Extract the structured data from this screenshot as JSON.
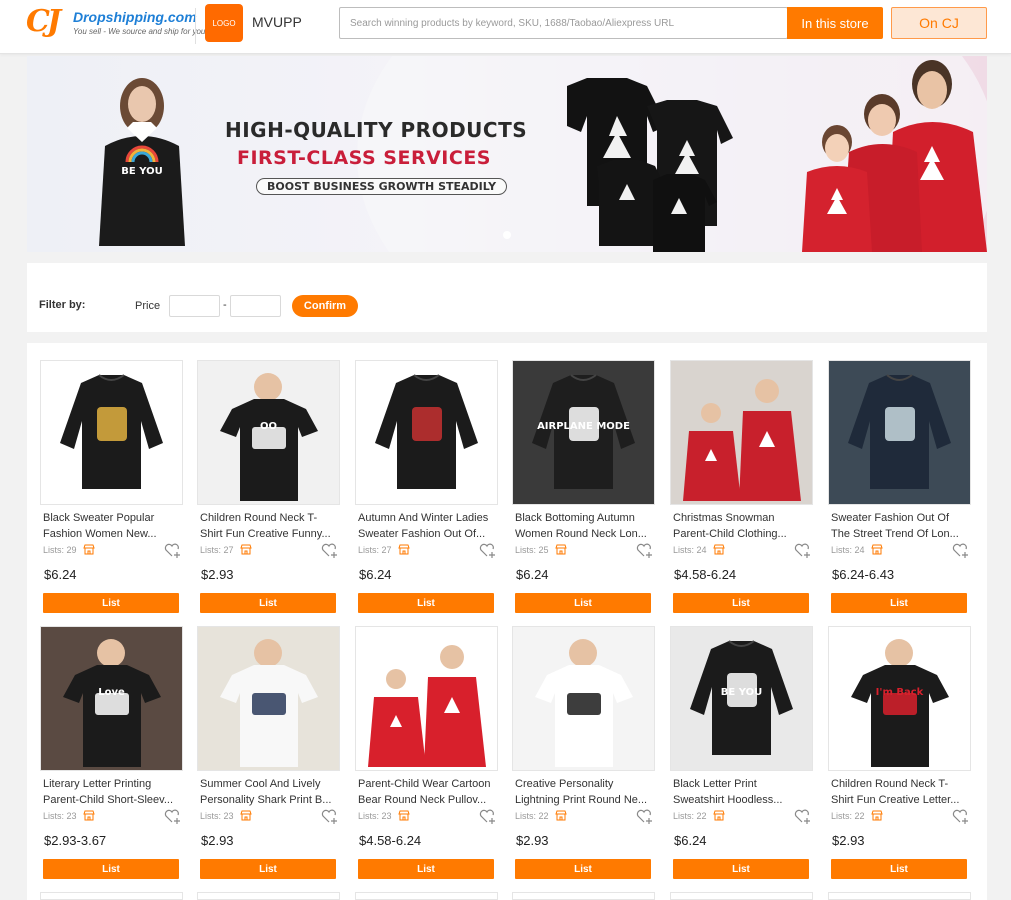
{
  "header": {
    "logo_name": "Dropshipping.com",
    "logo_tagline": "You sell - We source and ship for you!",
    "store_logo_text": "LOGO",
    "store_name": "MVUPP",
    "search_placeholder": "Search winning products by keyword, SKU, 1688/Taobao/Aliexpress URL",
    "in_store_label": "In this store",
    "on_cj_label": "On CJ"
  },
  "banner": {
    "line1": "HIGH-QUALITY  PRODUCTS",
    "line2": "FIRST-CLASS  SERVICES",
    "line3": "BOOST BUSINESS GROWTH STEADILY"
  },
  "filter": {
    "label": "Filter by:",
    "price_label": "Price",
    "separator": "-",
    "min_value": "",
    "max_value": "",
    "confirm_label": "Confirm"
  },
  "products": [
    {
      "title1": "Black Sweater Popular",
      "title2": "Fashion Women New...",
      "lists": "Lists: 29",
      "price": "$6.24",
      "button": "List"
    },
    {
      "title1": "Children Round Neck T-",
      "title2": "Shirt Fun Creative Funny...",
      "lists": "Lists: 27",
      "price": "$2.93",
      "button": "List"
    },
    {
      "title1": "Autumn And Winter Ladies",
      "title2": "Sweater Fashion Out Of...",
      "lists": "Lists: 27",
      "price": "$6.24",
      "button": "List"
    },
    {
      "title1": "Black Bottoming Autumn",
      "title2": "Women Round Neck Lon...",
      "lists": "Lists: 25",
      "price": "$6.24",
      "button": "List"
    },
    {
      "title1": "Christmas Snowman",
      "title2": "Parent-Child Clothing...",
      "lists": "Lists: 24",
      "price": "$4.58-6.24",
      "button": "List"
    },
    {
      "title1": "Sweater Fashion Out Of",
      "title2": "The Street Trend Of Lon...",
      "lists": "Lists: 24",
      "price": "$6.24-6.43",
      "button": "List"
    },
    {
      "title1": "Literary Letter Printing",
      "title2": "Parent-Child Short-Sleev...",
      "lists": "Lists: 23",
      "price": "$2.93-3.67",
      "button": "List"
    },
    {
      "title1": "Summer Cool And Lively",
      "title2": "Personality Shark Print B...",
      "lists": "Lists: 23",
      "price": "$2.93",
      "button": "List"
    },
    {
      "title1": "Parent-Child Wear Cartoon",
      "title2": "Bear Round Neck Pullov...",
      "lists": "Lists: 23",
      "price": "$4.58-6.24",
      "button": "List"
    },
    {
      "title1": "Creative Personality",
      "title2": "Lightning Print Round Ne...",
      "lists": "Lists: 22",
      "price": "$2.93",
      "button": "List"
    },
    {
      "title1": "Black Letter Print",
      "title2": "Sweatshirt Hoodless...",
      "lists": "Lists: 22",
      "price": "$6.24",
      "button": "List"
    },
    {
      "title1": "Children Round Neck T-",
      "title2": "Shirt Fun Creative Letter...",
      "lists": "Lists: 22",
      "price": "$2.93",
      "button": "List"
    }
  ],
  "thumb_art": {
    "1": {
      "bg": "#ffffff",
      "item": "sweater",
      "color": "#1b1b1b",
      "print_text": "",
      "print_color": "#e0b040"
    },
    "2": {
      "bg": "#f1f1f1",
      "item": "tee",
      "color": "#1b1b1b",
      "print_text": "OO",
      "print_color": "#ffffff"
    },
    "3": {
      "bg": "#ffffff",
      "item": "sweater",
      "color": "#1b1b1b",
      "print_text": "",
      "print_color": "#c53030"
    },
    "4": {
      "bg": "#3a3a3a",
      "item": "sweater",
      "color": "#1e1e1e",
      "print_text": "AIRPLANE MODE",
      "print_color": "#ffffff"
    },
    "5": {
      "bg": "#d9d4cf",
      "item": "family",
      "color": "#c8202c",
      "print_text": "",
      "print_color": "#ffffff"
    },
    "6": {
      "bg": "#3d4a56",
      "item": "sweater",
      "color": "#1f2a3a",
      "print_text": "",
      "print_color": "#c9d9e0"
    },
    "7": {
      "bg": "#5a4a42",
      "item": "tee",
      "color": "#1b1b1b",
      "print_text": "Love",
      "print_color": "#ffffff"
    },
    "8": {
      "bg": "#e7e3da",
      "item": "tee",
      "color": "#f8f8f8",
      "print_text": "",
      "print_color": "#2a3a5a"
    },
    "9": {
      "bg": "#ffffff",
      "item": "family",
      "color": "#d8202c",
      "print_text": "",
      "print_color": "#ffffff"
    },
    "10": {
      "bg": "#f4f4f4",
      "item": "tee",
      "color": "#ffffff",
      "print_text": "",
      "print_color": "#1b1b1b"
    },
    "11": {
      "bg": "#e9e9e9",
      "item": "sweater",
      "color": "#1b1b1b",
      "print_text": "BE YOU",
      "print_color": "#ffffff"
    },
    "12": {
      "bg": "#ffffff",
      "item": "tee",
      "color": "#1b1b1b",
      "print_text": "I'm Back",
      "print_color": "#d8202c"
    }
  }
}
